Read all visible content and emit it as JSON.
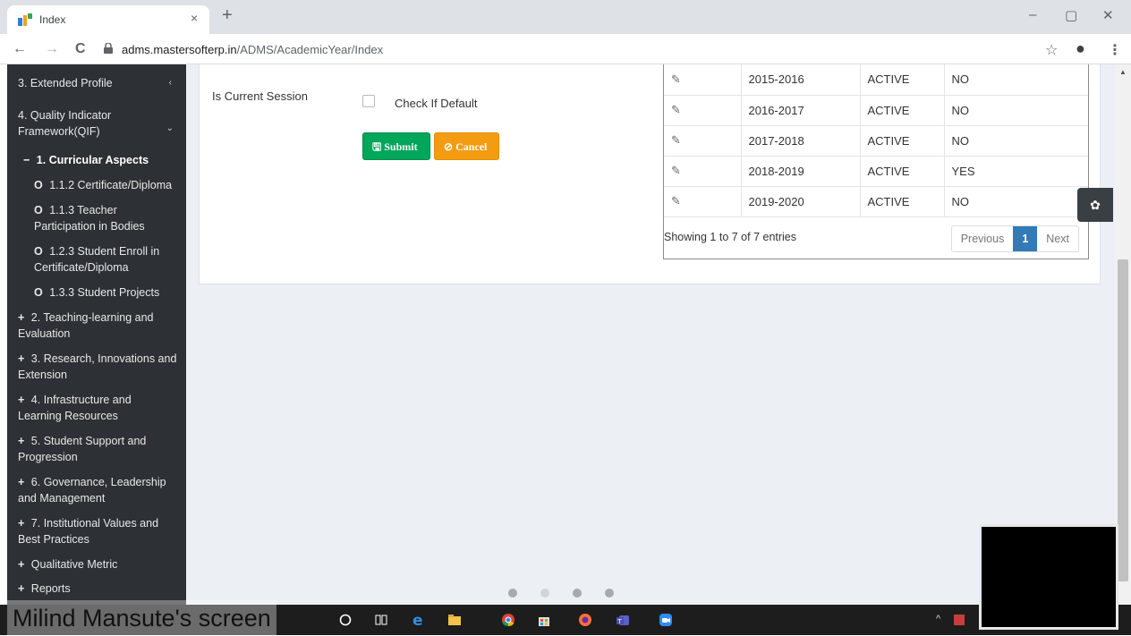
{
  "browser": {
    "tab_title": "Index",
    "tab_close": "×",
    "new_tab": "+",
    "window_controls": [
      "–",
      "▢",
      "✕"
    ],
    "nav": {
      "back": "←",
      "forward": "→",
      "reload": "C"
    },
    "url_host": "adms.mastersofterp.in",
    "url_path": "/ADMS/AcademicYear/Index",
    "star_icon": "☆",
    "profile_icon": "●",
    "menu_icon": "⋮"
  },
  "sidebar": {
    "items": [
      {
        "label": "3. Extended Profile",
        "glyph": "",
        "chevron": "‹"
      },
      {
        "label": "4. Quality Indicator Framework(QIF)",
        "glyph": "",
        "chevron": "⌄"
      },
      {
        "label": "1. Curricular Aspects",
        "glyph": "−"
      },
      {
        "label": "1.1.2 Certificate/Diploma",
        "glyph": "O"
      },
      {
        "label": "1.1.3 Teacher Participation in Bodies",
        "glyph": "O"
      },
      {
        "label": "1.2.3 Student Enroll in Certificate/Diploma",
        "glyph": "O"
      },
      {
        "label": "1.3.3 Student Projects",
        "glyph": "O"
      },
      {
        "label": "2. Teaching-learning and Evaluation",
        "glyph": "+"
      },
      {
        "label": "3. Research, Innovations and Extension",
        "glyph": "+"
      },
      {
        "label": "4. Infrastructure and Learning Resources",
        "glyph": "+"
      },
      {
        "label": "5. Student Support and Progression",
        "glyph": "+"
      },
      {
        "label": "6. Governance, Leadership and Management",
        "glyph": "+"
      },
      {
        "label": "7. Institutional Values and Best Practices",
        "glyph": "+"
      },
      {
        "label": "Qualitative Metric",
        "glyph": "+"
      },
      {
        "label": "Reports",
        "glyph": "+"
      }
    ]
  },
  "form": {
    "current_session_label": "Is Current Session",
    "default_checkbox_label": "Check If Default",
    "submit_label": "Submit",
    "cancel_label": "Cancel",
    "submit_icon": "🖫",
    "cancel_icon": "⊘"
  },
  "table": {
    "rows": [
      {
        "year": "2015-2016",
        "status": "ACTIVE",
        "current": "NO"
      },
      {
        "year": "2016-2017",
        "status": "ACTIVE",
        "current": "NO"
      },
      {
        "year": "2017-2018",
        "status": "ACTIVE",
        "current": "NO"
      },
      {
        "year": "2018-2019",
        "status": "ACTIVE",
        "current": "YES"
      },
      {
        "year": "2019-2020",
        "status": "ACTIVE",
        "current": "NO"
      }
    ],
    "edit_icon": "✎",
    "info": "Showing 1 to 7 of 7 entries",
    "pager": {
      "previous": "Previous",
      "page": "1",
      "next": "Next"
    }
  },
  "overlay": {
    "screen_share_label": "Milind Mansute's screen",
    "gear_icon": "✿"
  },
  "colors": {
    "sidebar_bg": "#2d3035",
    "content_bg": "#ecf0f5",
    "submit": "#00a65a",
    "cancel": "#f39c12",
    "pager_active": "#337ab7"
  }
}
